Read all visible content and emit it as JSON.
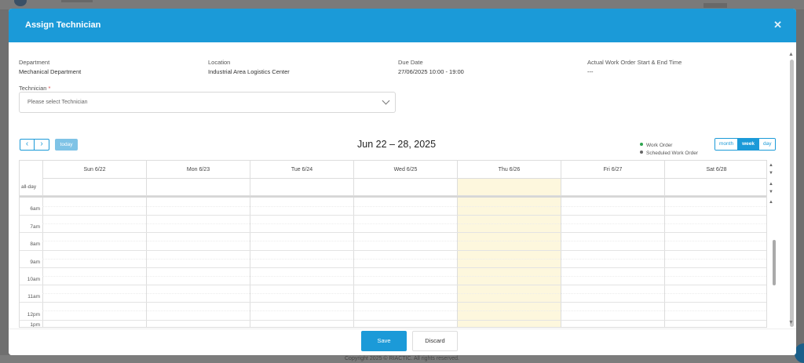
{
  "modal": {
    "title": "Assign Technician",
    "close_icon": "close-icon"
  },
  "info": [
    {
      "label": "Department",
      "value": "Mechanical Department"
    },
    {
      "label": "Location",
      "value": "Industrial Area Logistics Center"
    },
    {
      "label": "Due Date",
      "value": "27/06/2025 10:00 - 19:00"
    },
    {
      "label": "Actual Work Order Start & End Time",
      "value": "---"
    }
  ],
  "technician": {
    "label": "Technician",
    "required_mark": "*",
    "placeholder": "Please select Technician"
  },
  "calendar": {
    "prev_icon": "chevron-left-icon",
    "next_icon": "chevron-right-icon",
    "prev_glyph": "‹",
    "next_glyph": "›",
    "today_label": "today",
    "title": "Jun 22 – 28, 2025",
    "legend": [
      {
        "label": "Work Order",
        "color": "#2ea44f"
      },
      {
        "label": "Scheduled Work Order",
        "color": "#666666"
      }
    ],
    "views": [
      {
        "label": "month",
        "active": false
      },
      {
        "label": "week",
        "active": true
      },
      {
        "label": "day",
        "active": false
      }
    ],
    "days": [
      "Sun 6/22",
      "Mon 6/23",
      "Tue 6/24",
      "Wed 6/25",
      "Thu 6/26",
      "Fri 6/27",
      "Sat 6/28"
    ],
    "today_index": 4,
    "allday_label": "all-day",
    "hours": [
      "6am",
      "7am",
      "8am",
      "9am",
      "10am",
      "11am",
      "12pm",
      "1pm"
    ]
  },
  "footer": {
    "save_label": "Save",
    "discard_label": "Discard"
  },
  "background": {
    "footer_text": "Copyright 2025 © RIACTIC. All rights reserved."
  }
}
